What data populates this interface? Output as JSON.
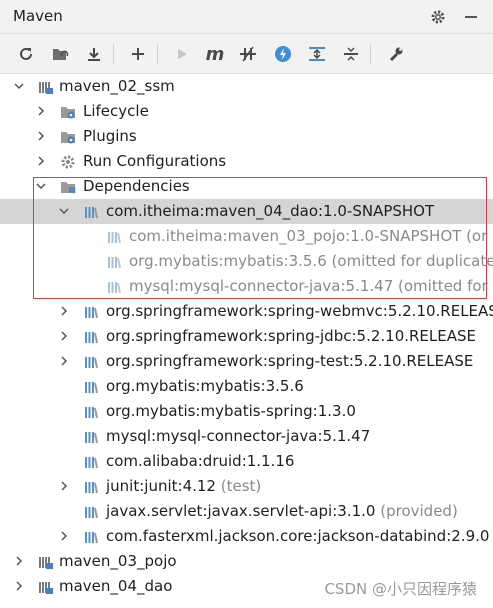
{
  "window": {
    "title": "Maven"
  },
  "header_icons": [
    "gear-icon",
    "minimize-icon"
  ],
  "toolbar": {
    "buttons": [
      {
        "name": "reload-icon",
        "enabled": true
      },
      {
        "name": "generate-sources-icon",
        "enabled": true
      },
      {
        "name": "download-icon",
        "enabled": true
      },
      {
        "name": "add-icon",
        "enabled": true
      },
      {
        "name": "run-icon",
        "enabled": false
      },
      {
        "name": "execute-goal-icon",
        "enabled": true,
        "glyph": "m"
      },
      {
        "name": "toggle-offline-icon",
        "enabled": true
      },
      {
        "name": "skip-tests-icon",
        "enabled": true
      },
      {
        "name": "show-dependencies-icon",
        "enabled": true
      },
      {
        "name": "collapse-all-icon",
        "enabled": true
      },
      {
        "name": "settings-wrench-icon",
        "enabled": true
      }
    ]
  },
  "tree": {
    "project_1": "maven_02_ssm",
    "lifecycle": "Lifecycle",
    "plugins": "Plugins",
    "run_configurations": "Run Configurations",
    "dependencies": "Dependencies",
    "dao": "com.itheima:maven_04_dao:1.0-SNAPSHOT",
    "dao_children": [
      "com.itheima:maven_03_pojo:1.0-SNAPSHOT (or",
      "org.mybatis:mybatis:3.5.6 (omitted for duplicate",
      "mysql:mysql-connector-java:5.1.47 (omitted for"
    ],
    "deps": [
      "org.springframework:spring-webmvc:5.2.10.RELEAS",
      "org.springframework:spring-jdbc:5.2.10.RELEASE",
      "org.springframework:spring-test:5.2.10.RELEASE",
      "org.mybatis:mybatis:3.5.6",
      "org.mybatis:mybatis-spring:1.3.0",
      "mysql:mysql-connector-java:5.1.47",
      "com.alibaba:druid:1.1.16",
      "junit:junit:4.12",
      "javax.servlet:javax.servlet-api:3.1.0",
      "com.fasterxml.jackson.core:jackson-databind:2.9.0"
    ],
    "junit_scope": "(test)",
    "servlet_scope": "(provided)",
    "project_2": "maven_03_pojo",
    "project_3": "maven_04_dao"
  },
  "watermark": "CSDN @小只因程序猿",
  "colors": {
    "highlight_border": "#d14343",
    "selected_row": "#d5d5d5",
    "library_icon": "#5b8fc7"
  }
}
